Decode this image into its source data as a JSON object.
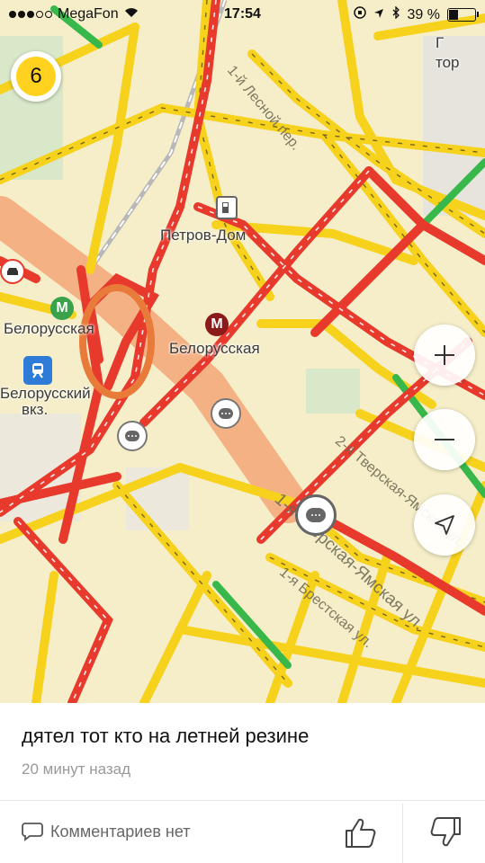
{
  "status_bar": {
    "carrier": "MegaFon",
    "time": "17:54",
    "battery": "39 %"
  },
  "map": {
    "traffic_level": "6",
    "colors": {
      "base": "#f5eec9",
      "free": "#38b84a",
      "medium": "#f7d21c",
      "heavy": "#e8392d"
    },
    "labels": {
      "petrov_house": "Петров-Дом",
      "belorusskaya_left": "Белорусская",
      "belorusskaya_center": "Белорусская",
      "belorussky_station": "Белорусский",
      "vokzal": "вкз.",
      "street_lesnoy": "1-й Лесной пер.",
      "street_tverskaya_yamskaya": "1-я Тверская-Ямская ул.",
      "street_brestskaya": "1-я Брестская ул.",
      "street_2nd_tverskaya": "2-я Тверская-Ямская ул.",
      "top_right_label": "Г",
      "top_right_label2": "тор"
    },
    "icons": [
      "traffic-level-icon",
      "zoom-in-icon",
      "zoom-out-icon",
      "location-arrow-icon",
      "metro-icon",
      "train-icon",
      "comment-pin-icon",
      "car-icon",
      "fuel-icon"
    ]
  },
  "post": {
    "message": "дятел тот кто на летней резине",
    "time_ago": "20 минут назад",
    "comments_label": "Комментариев нет"
  }
}
